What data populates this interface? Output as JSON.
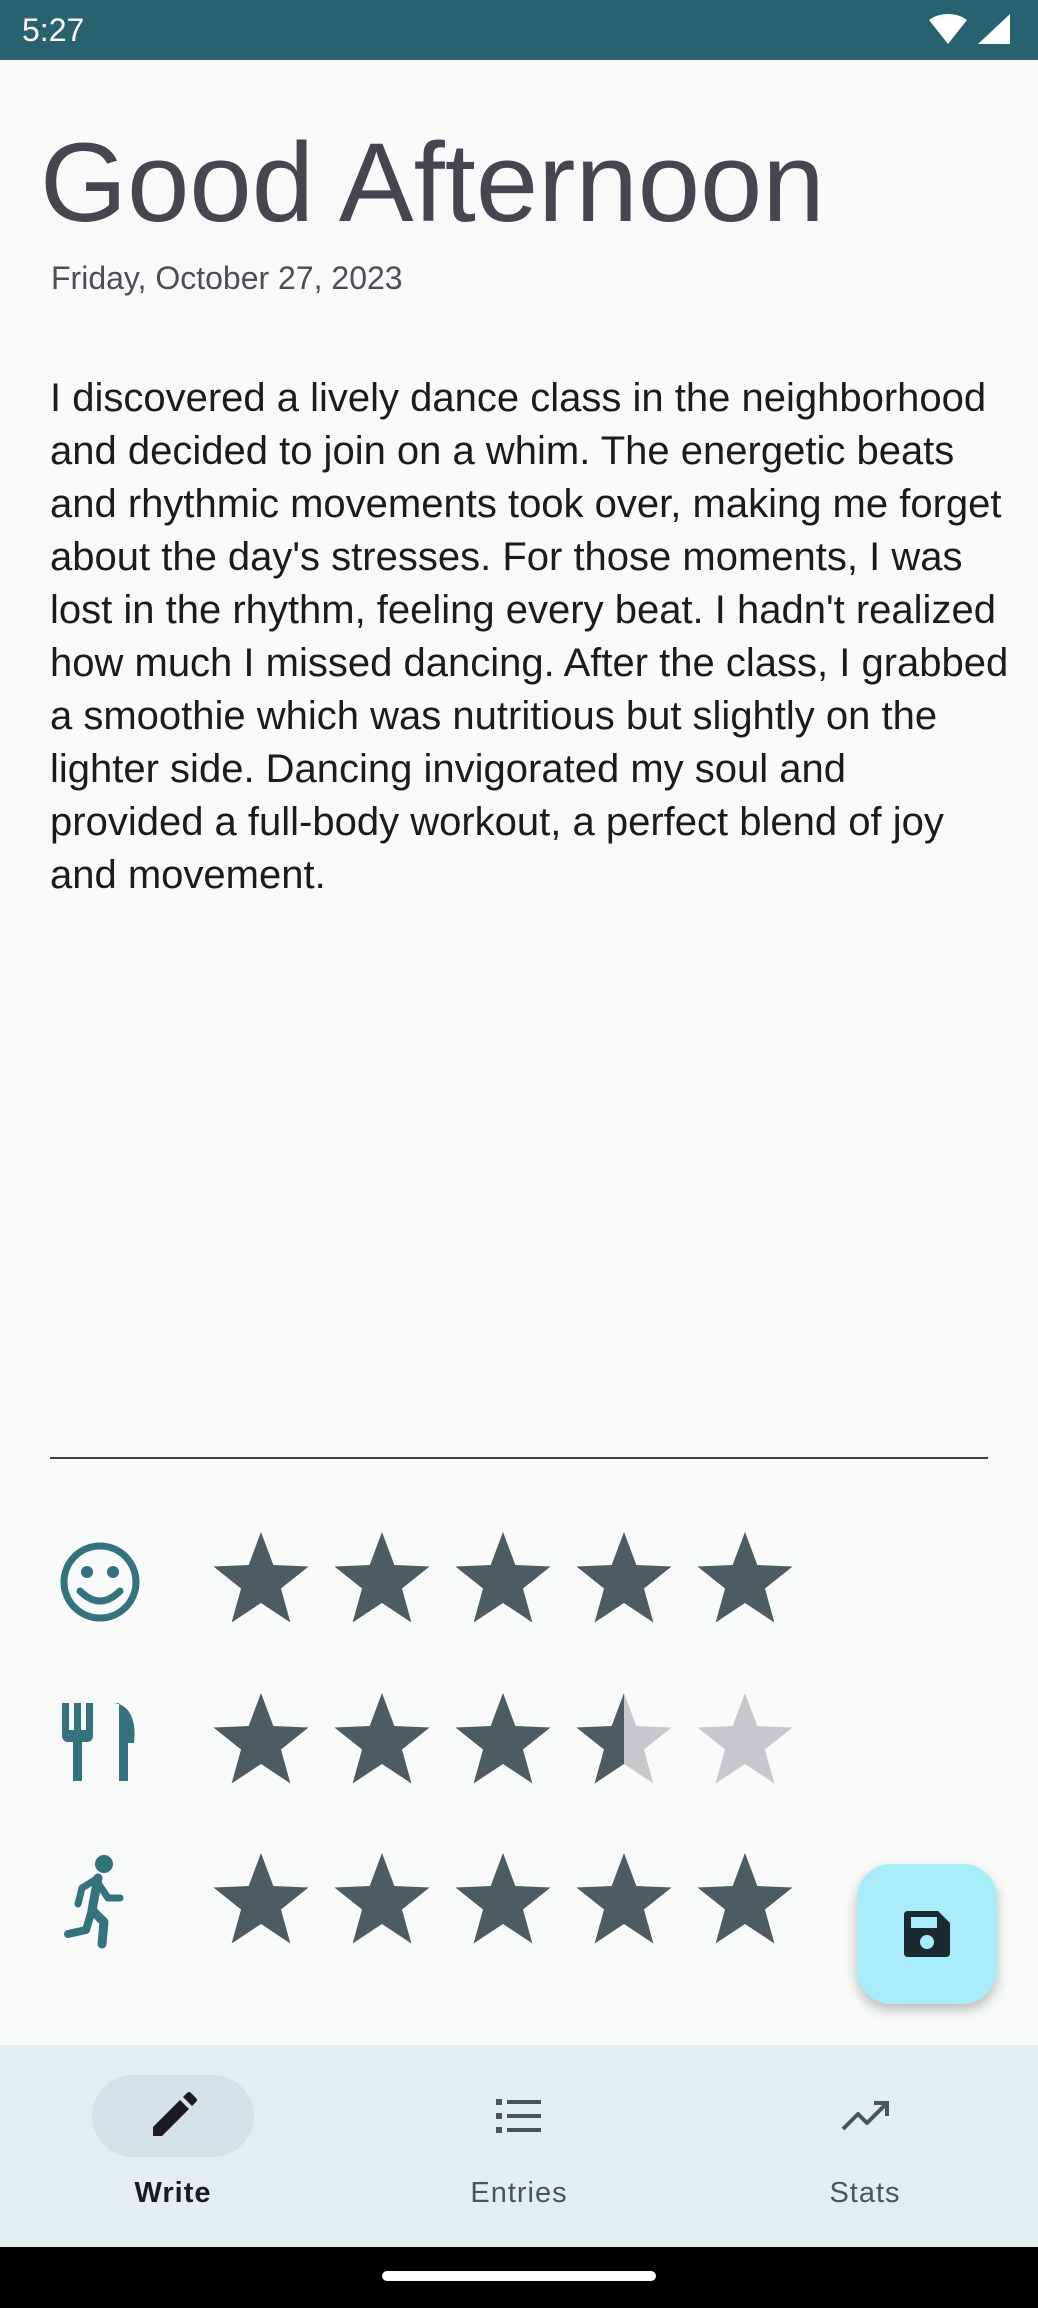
{
  "status_bar": {
    "time": "5:27",
    "icons": [
      "wifi-icon",
      "cellular-signal-icon"
    ]
  },
  "header": {
    "greeting": "Good Afternoon",
    "date": "Friday, October 27, 2023"
  },
  "journal": {
    "text": "I discovered a lively dance class in the neighborhood and decided to join on a whim. The energetic beats and rhythmic movements took over, making me forget about the day's stresses. For those moments, I was lost in the rhythm, feeling every beat. I hadn't realized how much I missed dancing. After the class, I grabbed a smoothie which was nutritious but slightly on the lighter side. Dancing invigorated my soul and provided a full-body workout, a perfect blend of joy and movement."
  },
  "ratings": [
    {
      "icon": "smiley-face-icon",
      "max": 5,
      "value": 5
    },
    {
      "icon": "fork-knife-icon",
      "max": 5,
      "value": 3.5
    },
    {
      "icon": "running-person-icon",
      "max": 5,
      "value": 5
    }
  ],
  "fab": {
    "icon": "save-icon"
  },
  "bottom_nav": {
    "items": [
      {
        "label": "Write",
        "icon": "pencil-icon",
        "active": true
      },
      {
        "label": "Entries",
        "icon": "list-icon",
        "active": false
      },
      {
        "label": "Stats",
        "icon": "trending-up-icon",
        "active": false
      }
    ]
  },
  "colors": {
    "status_bar": "#28616f",
    "star_filled": "#4c5c62",
    "star_empty": "#c8c8cc",
    "rating_icon": "#34727e",
    "fab_background": "#a8ecfa",
    "nav_background": "#e6edef"
  }
}
